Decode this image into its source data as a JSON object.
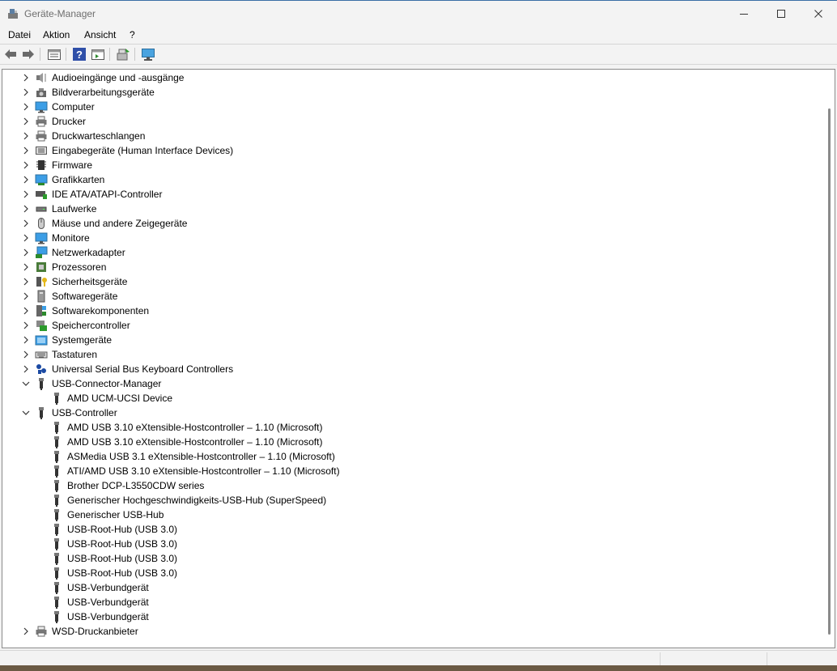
{
  "window": {
    "title": "Geräte-Manager"
  },
  "menu": [
    "Datei",
    "Aktion",
    "Ansicht",
    "?"
  ],
  "toolbar": [
    "back-icon",
    "forward-icon",
    "properties-view-icon",
    "help-icon",
    "update-driver-icon",
    "scan-hardware-icon",
    "monitor-icon"
  ],
  "tree": [
    {
      "label": "Audioeingänge und -ausgänge",
      "expanded": false,
      "icon": "speaker-icon",
      "children": []
    },
    {
      "label": "Bildverarbeitungsgeräte",
      "expanded": false,
      "icon": "camera-icon",
      "children": []
    },
    {
      "label": "Computer",
      "expanded": false,
      "icon": "computer-icon",
      "children": []
    },
    {
      "label": "Drucker",
      "expanded": false,
      "icon": "printer-icon",
      "children": []
    },
    {
      "label": "Druckwarteschlangen",
      "expanded": false,
      "icon": "printer-icon",
      "children": []
    },
    {
      "label": "Eingabegeräte (Human Interface Devices)",
      "expanded": false,
      "icon": "hid-icon",
      "children": []
    },
    {
      "label": "Firmware",
      "expanded": false,
      "icon": "firmware-chip-icon",
      "children": []
    },
    {
      "label": "Grafikkarten",
      "expanded": false,
      "icon": "display-adapter-icon",
      "children": []
    },
    {
      "label": "IDE ATA/ATAPI-Controller",
      "expanded": false,
      "icon": "ide-controller-icon",
      "children": []
    },
    {
      "label": "Laufwerke",
      "expanded": false,
      "icon": "disk-drive-icon",
      "children": []
    },
    {
      "label": "Mäuse und andere Zeigegeräte",
      "expanded": false,
      "icon": "mouse-icon",
      "children": []
    },
    {
      "label": "Monitore",
      "expanded": false,
      "icon": "monitor-icon",
      "children": []
    },
    {
      "label": "Netzwerkadapter",
      "expanded": false,
      "icon": "network-adapter-icon",
      "children": []
    },
    {
      "label": "Prozessoren",
      "expanded": false,
      "icon": "processor-icon",
      "children": []
    },
    {
      "label": "Sicherheitsgeräte",
      "expanded": false,
      "icon": "security-key-icon",
      "children": []
    },
    {
      "label": "Softwaregeräte",
      "expanded": false,
      "icon": "software-device-icon",
      "children": []
    },
    {
      "label": "Softwarekomponenten",
      "expanded": false,
      "icon": "software-component-icon",
      "children": []
    },
    {
      "label": "Speichercontroller",
      "expanded": false,
      "icon": "storage-controller-icon",
      "children": []
    },
    {
      "label": "Systemgeräte",
      "expanded": false,
      "icon": "system-folder-icon",
      "children": []
    },
    {
      "label": "Tastaturen",
      "expanded": false,
      "icon": "keyboard-icon",
      "children": []
    },
    {
      "label": "Universal Serial Bus Keyboard Controllers",
      "expanded": false,
      "icon": "usb-keyboard-controller-icon",
      "children": []
    },
    {
      "label": "USB-Connector-Manager",
      "expanded": true,
      "icon": "usb-plug-icon",
      "children": [
        "AMD UCM-UCSI Device"
      ]
    },
    {
      "label": "USB-Controller",
      "expanded": true,
      "icon": "usb-plug-icon",
      "children": [
        "AMD USB 3.10 eXtensible-Hostcontroller – 1.10 (Microsoft)",
        "AMD USB 3.10 eXtensible-Hostcontroller – 1.10 (Microsoft)",
        "ASMedia USB 3.1 eXtensible-Hostcontroller – 1.10 (Microsoft)",
        "ATI/AMD USB 3.10 eXtensible-Hostcontroller – 1.10 (Microsoft)",
        "Brother DCP-L3550CDW series",
        "Generischer Hochgeschwindigkeits-USB-Hub (SuperSpeed)",
        "Generischer USB-Hub",
        "USB-Root-Hub (USB 3.0)",
        "USB-Root-Hub (USB 3.0)",
        "USB-Root-Hub (USB 3.0)",
        "USB-Root-Hub (USB 3.0)",
        "USB-Verbundgerät",
        "USB-Verbundgerät",
        "USB-Verbundgerät"
      ]
    },
    {
      "label": "WSD-Druckanbieter",
      "expanded": false,
      "icon": "printer-icon",
      "children": []
    }
  ]
}
